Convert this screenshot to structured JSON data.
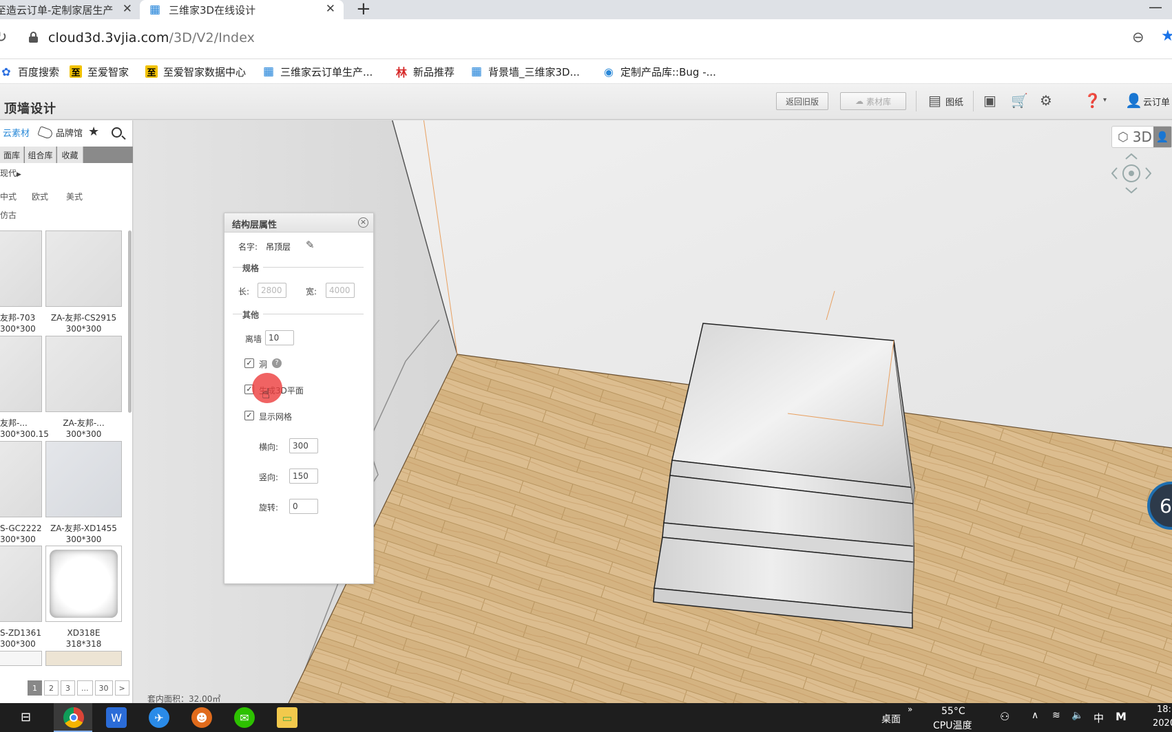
{
  "browser": {
    "tabs": [
      {
        "title": "至造云订单-定制家居生产",
        "favicon": "building-icon"
      },
      {
        "title": "三维家3D在线设计",
        "favicon": "building-icon"
      }
    ],
    "url_host": "cloud3d.3vjia.com",
    "url_path": "/3D/V2/Index",
    "bookmarks": [
      "百度搜索",
      "至爱智家",
      "至爱智家数据中心",
      "三维家云订单生产...",
      "新品推荐",
      "背景墙_三维家3D...",
      "定制产品库::Bug -..."
    ]
  },
  "app": {
    "title": "顶墙设计",
    "btn_old_version": "返回旧版",
    "btn_material_lib": "素材库",
    "btn_drawings": "图纸",
    "user_label": "云订单",
    "view_mode": "3D",
    "dial_value": "6",
    "area_label": "套内面积：32.00㎡"
  },
  "library": {
    "tab_cloud": "云素材",
    "tab_brand": "品牌馆",
    "subtabs": [
      "面库",
      "组合库",
      "收藏"
    ],
    "style_filter": "现代",
    "styles": [
      "中式",
      "欧式",
      "美式",
      "仿古"
    ],
    "items": [
      {
        "name": "友邦-703",
        "size": "300*300"
      },
      {
        "name": "ZA-友邦-CS2915",
        "size": "300*300"
      },
      {
        "name": "友邦-...",
        "size": "300*300.15"
      },
      {
        "name": "ZA-友邦-...",
        "size": "300*300"
      },
      {
        "name": "S-GC2222",
        "size": "300*300"
      },
      {
        "name": "ZA-友邦-XD1455",
        "size": "300*300"
      },
      {
        "name": "S-ZD1361",
        "size": "300*300"
      },
      {
        "name": "XD318E",
        "size": "318*318"
      }
    ],
    "pages": [
      "1",
      "2",
      "3",
      "...",
      "30",
      ">"
    ],
    "current_page": "1"
  },
  "dialog": {
    "title": "结构层属性",
    "name_label": "名字:",
    "name_value": "吊顶层",
    "section_spec": "规格",
    "length_label": "长:",
    "length_value": "2800",
    "width_label": "宽:",
    "width_value": "4000",
    "section_other": "其他",
    "wall_height_label": "离墙",
    "wall_height_value": "10",
    "hole_label": "洞",
    "hole_checked": true,
    "gen3d_label": "生成3D平面",
    "gen3d_checked": true,
    "grid_label": "显示网格",
    "grid_checked": true,
    "h_label": "横向:",
    "h_value": "300",
    "v_label": "竖向:",
    "v_value": "150",
    "rot_label": "旋转:",
    "rot_value": "0"
  },
  "taskbar": {
    "desktop_label": "桌面",
    "temp": "55°C",
    "cpu_label": "CPU温度",
    "ime": "中",
    "time": "18:",
    "date": "2020/"
  },
  "colors": {
    "accent": "#2b8ad8",
    "wood": "#d9b98a",
    "wall": "#e2e2e2"
  }
}
